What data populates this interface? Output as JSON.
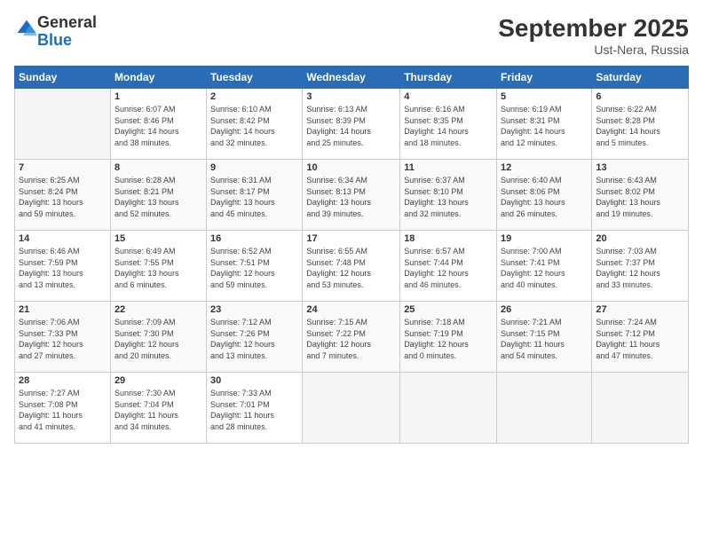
{
  "logo": {
    "general": "General",
    "blue": "Blue"
  },
  "header": {
    "title": "September 2025",
    "subtitle": "Ust-Nera, Russia"
  },
  "days_of_week": [
    "Sunday",
    "Monday",
    "Tuesday",
    "Wednesday",
    "Thursday",
    "Friday",
    "Saturday"
  ],
  "weeks": [
    [
      {
        "day": "",
        "info": ""
      },
      {
        "day": "1",
        "info": "Sunrise: 6:07 AM\nSunset: 8:46 PM\nDaylight: 14 hours\nand 38 minutes."
      },
      {
        "day": "2",
        "info": "Sunrise: 6:10 AM\nSunset: 8:42 PM\nDaylight: 14 hours\nand 32 minutes."
      },
      {
        "day": "3",
        "info": "Sunrise: 6:13 AM\nSunset: 8:39 PM\nDaylight: 14 hours\nand 25 minutes."
      },
      {
        "day": "4",
        "info": "Sunrise: 6:16 AM\nSunset: 8:35 PM\nDaylight: 14 hours\nand 18 minutes."
      },
      {
        "day": "5",
        "info": "Sunrise: 6:19 AM\nSunset: 8:31 PM\nDaylight: 14 hours\nand 12 minutes."
      },
      {
        "day": "6",
        "info": "Sunrise: 6:22 AM\nSunset: 8:28 PM\nDaylight: 14 hours\nand 5 minutes."
      }
    ],
    [
      {
        "day": "7",
        "info": "Sunrise: 6:25 AM\nSunset: 8:24 PM\nDaylight: 13 hours\nand 59 minutes."
      },
      {
        "day": "8",
        "info": "Sunrise: 6:28 AM\nSunset: 8:21 PM\nDaylight: 13 hours\nand 52 minutes."
      },
      {
        "day": "9",
        "info": "Sunrise: 6:31 AM\nSunset: 8:17 PM\nDaylight: 13 hours\nand 45 minutes."
      },
      {
        "day": "10",
        "info": "Sunrise: 6:34 AM\nSunset: 8:13 PM\nDaylight: 13 hours\nand 39 minutes."
      },
      {
        "day": "11",
        "info": "Sunrise: 6:37 AM\nSunset: 8:10 PM\nDaylight: 13 hours\nand 32 minutes."
      },
      {
        "day": "12",
        "info": "Sunrise: 6:40 AM\nSunset: 8:06 PM\nDaylight: 13 hours\nand 26 minutes."
      },
      {
        "day": "13",
        "info": "Sunrise: 6:43 AM\nSunset: 8:02 PM\nDaylight: 13 hours\nand 19 minutes."
      }
    ],
    [
      {
        "day": "14",
        "info": "Sunrise: 6:46 AM\nSunset: 7:59 PM\nDaylight: 13 hours\nand 13 minutes."
      },
      {
        "day": "15",
        "info": "Sunrise: 6:49 AM\nSunset: 7:55 PM\nDaylight: 13 hours\nand 6 minutes."
      },
      {
        "day": "16",
        "info": "Sunrise: 6:52 AM\nSunset: 7:51 PM\nDaylight: 12 hours\nand 59 minutes."
      },
      {
        "day": "17",
        "info": "Sunrise: 6:55 AM\nSunset: 7:48 PM\nDaylight: 12 hours\nand 53 minutes."
      },
      {
        "day": "18",
        "info": "Sunrise: 6:57 AM\nSunset: 7:44 PM\nDaylight: 12 hours\nand 46 minutes."
      },
      {
        "day": "19",
        "info": "Sunrise: 7:00 AM\nSunset: 7:41 PM\nDaylight: 12 hours\nand 40 minutes."
      },
      {
        "day": "20",
        "info": "Sunrise: 7:03 AM\nSunset: 7:37 PM\nDaylight: 12 hours\nand 33 minutes."
      }
    ],
    [
      {
        "day": "21",
        "info": "Sunrise: 7:06 AM\nSunset: 7:33 PM\nDaylight: 12 hours\nand 27 minutes."
      },
      {
        "day": "22",
        "info": "Sunrise: 7:09 AM\nSunset: 7:30 PM\nDaylight: 12 hours\nand 20 minutes."
      },
      {
        "day": "23",
        "info": "Sunrise: 7:12 AM\nSunset: 7:26 PM\nDaylight: 12 hours\nand 13 minutes."
      },
      {
        "day": "24",
        "info": "Sunrise: 7:15 AM\nSunset: 7:22 PM\nDaylight: 12 hours\nand 7 minutes."
      },
      {
        "day": "25",
        "info": "Sunrise: 7:18 AM\nSunset: 7:19 PM\nDaylight: 12 hours\nand 0 minutes."
      },
      {
        "day": "26",
        "info": "Sunrise: 7:21 AM\nSunset: 7:15 PM\nDaylight: 11 hours\nand 54 minutes."
      },
      {
        "day": "27",
        "info": "Sunrise: 7:24 AM\nSunset: 7:12 PM\nDaylight: 11 hours\nand 47 minutes."
      }
    ],
    [
      {
        "day": "28",
        "info": "Sunrise: 7:27 AM\nSunset: 7:08 PM\nDaylight: 11 hours\nand 41 minutes."
      },
      {
        "day": "29",
        "info": "Sunrise: 7:30 AM\nSunset: 7:04 PM\nDaylight: 11 hours\nand 34 minutes."
      },
      {
        "day": "30",
        "info": "Sunrise: 7:33 AM\nSunset: 7:01 PM\nDaylight: 11 hours\nand 28 minutes."
      },
      {
        "day": "",
        "info": ""
      },
      {
        "day": "",
        "info": ""
      },
      {
        "day": "",
        "info": ""
      },
      {
        "day": "",
        "info": ""
      }
    ]
  ]
}
